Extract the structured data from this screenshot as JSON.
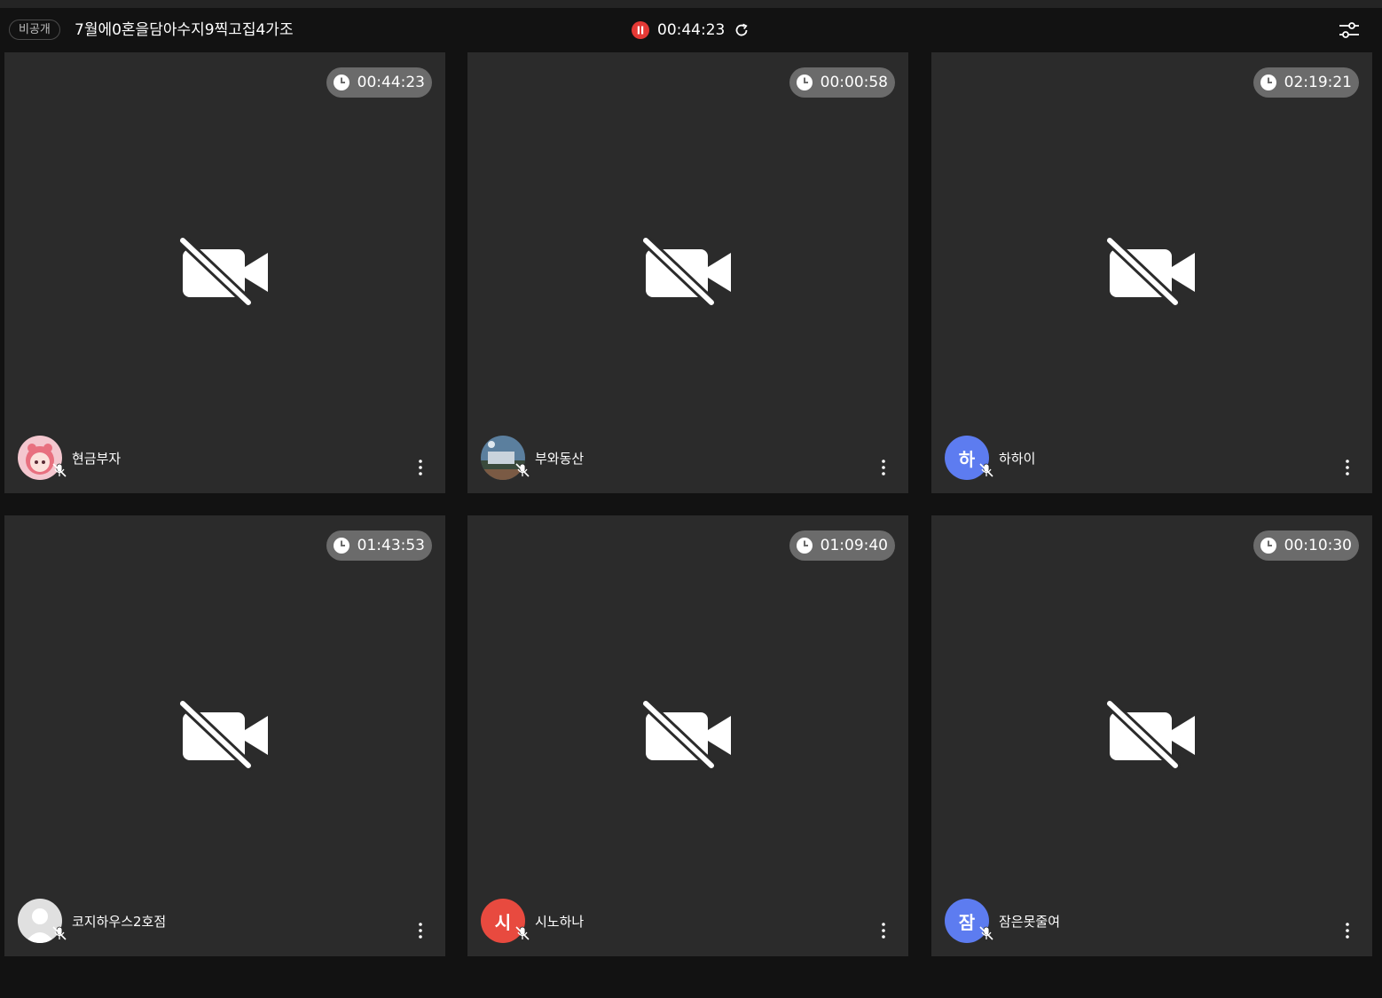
{
  "header": {
    "privacy_label": "비공개",
    "room_title": "7월에0혼을담아수지9찍고집4가조",
    "record_time": "00:44:23",
    "recording_color": "#e53935"
  },
  "tiles": [
    {
      "timer": "00:44:23",
      "name": "현금부자",
      "avatar": {
        "type": "image",
        "icon": "pink-character-avatar"
      }
    },
    {
      "timer": "00:00:58",
      "name": "부와동산",
      "avatar": {
        "type": "image",
        "icon": "landscape-photo-avatar"
      }
    },
    {
      "timer": "02:19:21",
      "name": "하하이",
      "avatar": {
        "type": "initial",
        "initial": "하",
        "color": "#5d7cf0"
      }
    },
    {
      "timer": "01:43:53",
      "name": "코지하우스2호점",
      "avatar": {
        "type": "image",
        "icon": "default-user-avatar"
      }
    },
    {
      "timer": "01:09:40",
      "name": "시노하나",
      "avatar": {
        "type": "initial",
        "initial": "시",
        "color": "#e84a3f"
      }
    },
    {
      "timer": "00:10:30",
      "name": "잠은못줄여",
      "avatar": {
        "type": "initial",
        "initial": "잠",
        "color": "#5d7cf0"
      }
    }
  ]
}
